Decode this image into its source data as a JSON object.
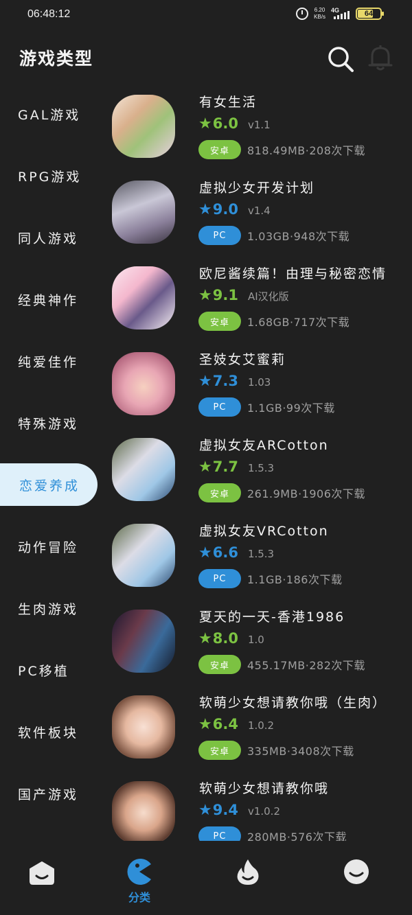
{
  "status_bar": {
    "time": "06:48:12",
    "net_speed_value": "6.20",
    "net_speed_unit": "KB/s",
    "network": "4G",
    "battery": "64"
  },
  "header": {
    "title": "游戏类型",
    "search_icon": "search-icon",
    "bell_icon": "bell-icon"
  },
  "sidebar": {
    "items": [
      {
        "label": "GAL游戏",
        "active": false
      },
      {
        "label": "RPG游戏",
        "active": false
      },
      {
        "label": "同人游戏",
        "active": false
      },
      {
        "label": "经典神作",
        "active": false
      },
      {
        "label": "纯爱佳作",
        "active": false
      },
      {
        "label": "特殊游戏",
        "active": false
      },
      {
        "label": "恋爱养成",
        "active": true
      },
      {
        "label": "动作冒险",
        "active": false
      },
      {
        "label": "生肉游戏",
        "active": false
      },
      {
        "label": "PC移植",
        "active": false
      },
      {
        "label": "软件板块",
        "active": false
      },
      {
        "label": "国产游戏",
        "active": false
      }
    ]
  },
  "colors": {
    "background": "#202020",
    "android_badge": "#7cc242",
    "pc_badge": "#2f8fd8",
    "accent": "#2f8fd8",
    "active_tab_bg": "#dff0fa"
  },
  "games": [
    {
      "title": "有女生活",
      "score": "6.0",
      "version": "v1.1",
      "platform": "安卓",
      "meta": "818.49MB·208次下载"
    },
    {
      "title": "虚拟少女开发计划",
      "score": "9.0",
      "version": "v1.4",
      "platform": "PC",
      "meta": "1.03GB·948次下载"
    },
    {
      "title": "欧尼酱续篇！由理与秘密恋情",
      "score": "9.1",
      "version": "AI汉化版",
      "platform": "安卓",
      "meta": "1.68GB·717次下载"
    },
    {
      "title": "圣妓女艾蜜莉",
      "score": "7.3",
      "version": "1.03",
      "platform": "PC",
      "meta": "1.1GB·99次下载"
    },
    {
      "title": "虚拟女友ARCotton",
      "score": "7.7",
      "version": "1.5.3",
      "platform": "安卓",
      "meta": "261.9MB·1906次下载"
    },
    {
      "title": "虚拟女友VRCotton",
      "score": "6.6",
      "version": "1.5.3",
      "platform": "PC",
      "meta": "1.1GB·186次下载"
    },
    {
      "title": "夏天的一天-香港1986",
      "score": "8.0",
      "version": "1.0",
      "platform": "安卓",
      "meta": "455.17MB·282次下载"
    },
    {
      "title": "软萌少女想请教你哦（生肉）",
      "score": "6.4",
      "version": "1.0.2",
      "platform": "安卓",
      "meta": "335MB·3408次下载"
    },
    {
      "title": "软萌少女想请教你哦",
      "score": "9.4",
      "version": "v1.0.2",
      "platform": "PC",
      "meta": "280MB·576次下载"
    }
  ],
  "bottom_nav": {
    "items": [
      {
        "icon": "home-icon"
      },
      {
        "icon": "pacman-icon",
        "label": "分类",
        "active": true
      },
      {
        "icon": "flame-icon"
      },
      {
        "icon": "profile-icon"
      }
    ]
  }
}
